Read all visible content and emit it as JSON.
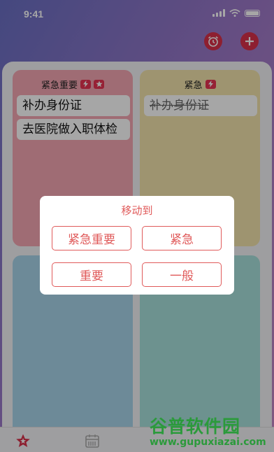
{
  "status_bar": {
    "time": "9:41"
  },
  "header": {
    "alarm_icon": "alarm-clock-icon",
    "add_icon": "plus-icon",
    "accent_color": "#d9304a"
  },
  "quadrants": [
    {
      "title": "紧急重要",
      "badges": [
        "lightning-icon",
        "star-icon"
      ],
      "color": "#f4a6b2",
      "tasks": [
        {
          "text": "补办身份证",
          "done": false
        },
        {
          "text": "去医院做入职体检",
          "done": false
        }
      ]
    },
    {
      "title": "紧急",
      "badges": [
        "lightning-icon"
      ],
      "color": "#f3e4ad",
      "tasks": [
        {
          "text": "补办身份证",
          "done": true
        }
      ]
    },
    {
      "color": "#a8d4ea",
      "tasks": []
    },
    {
      "color": "#a8e0dc",
      "tasks": []
    }
  ],
  "dialog": {
    "title": "移动到",
    "options": [
      "紧急重要",
      "紧急",
      "重要",
      "一般"
    ]
  },
  "tabbar": {
    "items": [
      "star-tab-icon",
      "calendar-tab-icon"
    ]
  },
  "watermark": {
    "title": "谷普软件园",
    "url": "www.gupuxiazai.com"
  }
}
